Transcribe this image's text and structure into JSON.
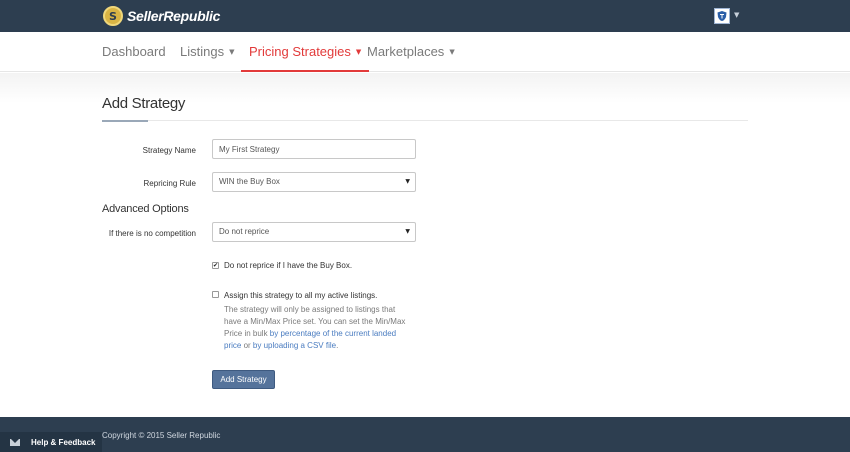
{
  "brand": {
    "logo_glyph": "S",
    "name": "SellerRepublic"
  },
  "user": {
    "avatar_icon": "shield-avatar-icon",
    "caret": "▼"
  },
  "nav": {
    "items": [
      {
        "label": "Dashboard",
        "caret": ""
      },
      {
        "label": "Listings",
        "caret": "▼"
      },
      {
        "label": "Pricing Strategies",
        "caret": "▼"
      },
      {
        "label": "Marketplaces",
        "caret": "▼"
      }
    ],
    "active": "Pricing Strategies",
    "active_color": "#e23a3a"
  },
  "page": {
    "title": "Add Strategy"
  },
  "form": {
    "strategy_name": {
      "label": "Strategy Name",
      "value": "My First Strategy"
    },
    "repricing_rule": {
      "label": "Repricing Rule",
      "value": "WIN the Buy Box",
      "arrow": "▼"
    },
    "advanced_title": "Advanced Options",
    "no_competition": {
      "label": "If there is no competition",
      "value": "Do not reprice",
      "arrow": "▼"
    },
    "no_reprice_buybox": {
      "label": "Do not reprice if I have the Buy Box.",
      "checked": true,
      "mark": "✔"
    },
    "assign_all": {
      "label": "Assign this strategy to all my active listings.",
      "checked": false
    },
    "help": {
      "text": "The strategy will only be assigned to listings that have a Min/Max Price set. You can set the Min/Max Price in bulk ",
      "link1": "by percentage of the current landed price",
      "joiner": " or ",
      "link2": "by uploading a CSV file",
      "end": "."
    },
    "submit_label": "Add Strategy"
  },
  "footer": {
    "copyright": "Copyright © 2015 Seller Republic"
  },
  "help_tab": {
    "label": "Help & Feedback",
    "icon": "envelope-icon"
  },
  "colors": {
    "topbar": "#2d3e50",
    "button": "#55739b",
    "link": "#4a7cc0"
  }
}
